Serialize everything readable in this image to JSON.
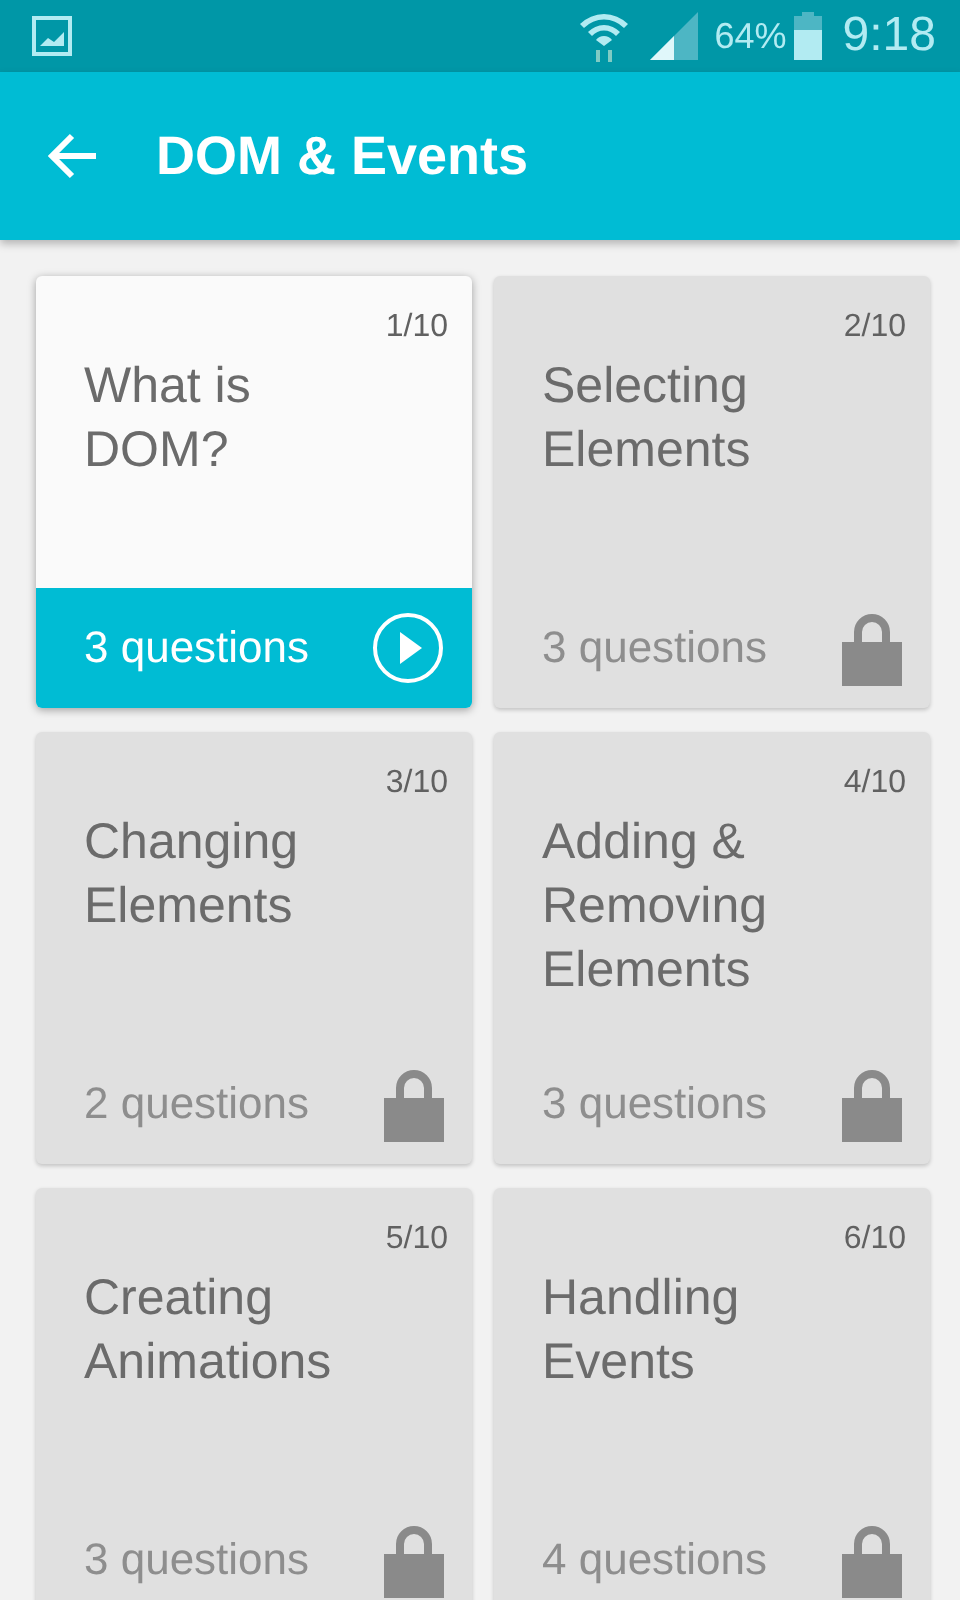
{
  "status_bar": {
    "battery": "64%",
    "time": "9:18"
  },
  "app_bar": {
    "title": "DOM & Events"
  },
  "lessons": [
    {
      "number": "1/10",
      "title": "What is\nDOM?",
      "questions": "3 questions",
      "locked": false
    },
    {
      "number": "2/10",
      "title": "Selecting\nElements",
      "questions": "3 questions",
      "locked": true
    },
    {
      "number": "3/10",
      "title": "Changing\nElements",
      "questions": "2 questions",
      "locked": true
    },
    {
      "number": "4/10",
      "title": "Adding &\nRemoving\nElements",
      "questions": "3 questions",
      "locked": true
    },
    {
      "number": "5/10",
      "title": "Creating\nAnimations",
      "questions": "3 questions",
      "locked": true
    },
    {
      "number": "6/10",
      "title": "Handling\nEvents",
      "questions": "4 questions",
      "locked": true
    }
  ]
}
